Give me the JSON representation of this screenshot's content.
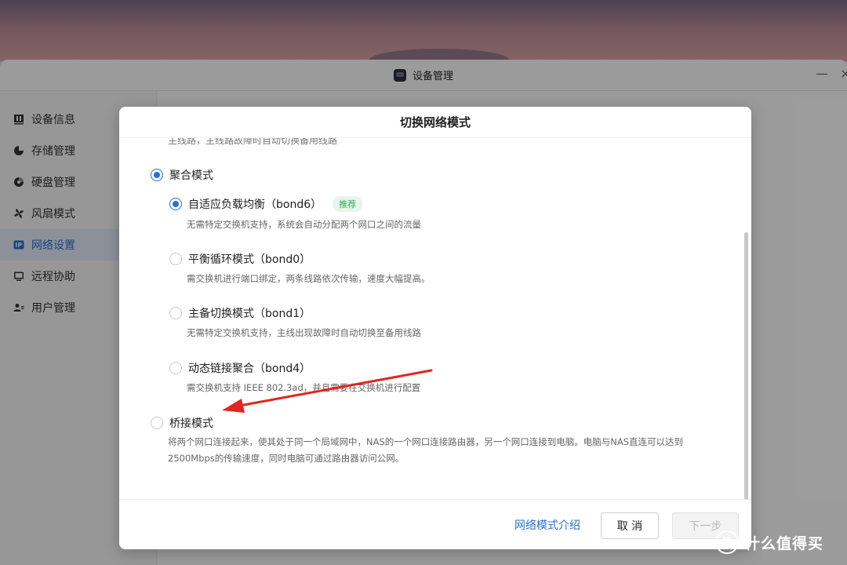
{
  "window": {
    "title": "设备管理",
    "minimize_glyph": "—",
    "close_glyph": "×"
  },
  "sidebar": {
    "items": [
      {
        "label": "设备信息",
        "icon": "device-info-icon"
      },
      {
        "label": "存储管理",
        "icon": "pie-chart-icon"
      },
      {
        "label": "硬盘管理",
        "icon": "disk-icon"
      },
      {
        "label": "风扇模式",
        "icon": "fan-icon"
      },
      {
        "label": "网络设置",
        "icon": "ip-icon",
        "active": true
      },
      {
        "label": "远程协助",
        "icon": "monitor-icon"
      },
      {
        "label": "用户管理",
        "icon": "users-icon"
      }
    ]
  },
  "dialog": {
    "title": "切换网络模式",
    "cut_text": "主线路，主线路故障时自动切换备用线路",
    "aggregate": {
      "label": "聚合模式",
      "checked": true,
      "options": [
        {
          "label": "自适应负载均衡（bond6）",
          "badge": "推荐",
          "checked": true,
          "desc": "无需特定交换机支持，系统会自动分配两个网口之间的流量"
        },
        {
          "label": "平衡循环模式（bond0）",
          "checked": false,
          "desc": "需交换机进行端口绑定，两条线路依次传输，速度大幅提高。"
        },
        {
          "label": "主备切换模式（bond1）",
          "checked": false,
          "desc": "无需特定交换机支持，主线出现故障时自动切换至备用线路"
        },
        {
          "label": "动态链接聚合（bond4）",
          "checked": false,
          "desc": "需交换机支持 IEEE 802.3ad，并且需要在交换机进行配置"
        }
      ]
    },
    "bridge": {
      "label": "桥接模式",
      "checked": false,
      "desc_line1": "将两个网口连接起来，使其处于同一个局域网中，NAS的一个网口连接路由器，另一个网口连接到电脑。电脑与NAS直连可以达到",
      "desc_line2": "2500Mbps的传输速度，同时电脑可通过路由器访问公网。"
    },
    "footer": {
      "intro_link": "网络模式介绍",
      "cancel": "取 消",
      "next": "下一步"
    }
  },
  "watermark": {
    "logo_text": "值",
    "text": "什么值得买"
  },
  "colors": {
    "accent": "#2a6fd6",
    "badge_green": "#3aa55b",
    "arrow_red": "#e0261f"
  }
}
